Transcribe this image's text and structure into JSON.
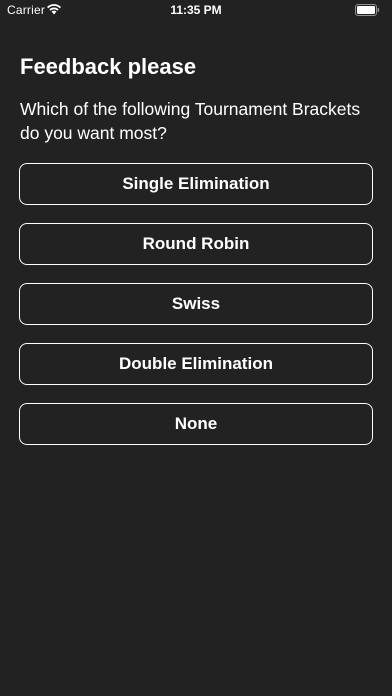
{
  "status_bar": {
    "carrier": "Carrier",
    "time": "11:35 PM",
    "icons": [
      "wifi-icon",
      "battery-icon"
    ]
  },
  "survey": {
    "title": "Feedback please",
    "question": "Which of the following Tournament Brackets do you want most?",
    "options": [
      "Single Elimination",
      "Round Robin",
      "Swiss",
      "Double Elimination",
      "None"
    ]
  },
  "colors": {
    "background": "#222222",
    "text": "#ffffff",
    "button_border": "#ffffff"
  }
}
